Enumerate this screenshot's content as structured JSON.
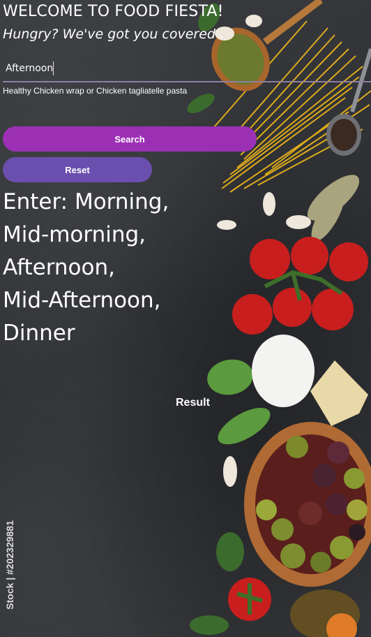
{
  "header": {
    "title": "WELCOME TO FOOD FIESTA!",
    "subtitle": "Hungry? We've got you covered ."
  },
  "meal_input": {
    "value": "Afternoon"
  },
  "suggestion": "Healthy Chicken wrap or Chicken tagliatelle pasta",
  "buttons": {
    "search_label": "Search",
    "reset_label": "Reset"
  },
  "instructions": {
    "lines": [
      "Enter: Morning,",
      "Mid-morning,",
      "Afternoon,",
      "Mid-Afternoon,",
      "Dinner"
    ]
  },
  "result_label": "Result",
  "watermark": "Stock | #202329881",
  "colors": {
    "search_button": "#9b30b5",
    "reset_button": "#6b4fae",
    "input_underline": "#8c7fa3"
  }
}
